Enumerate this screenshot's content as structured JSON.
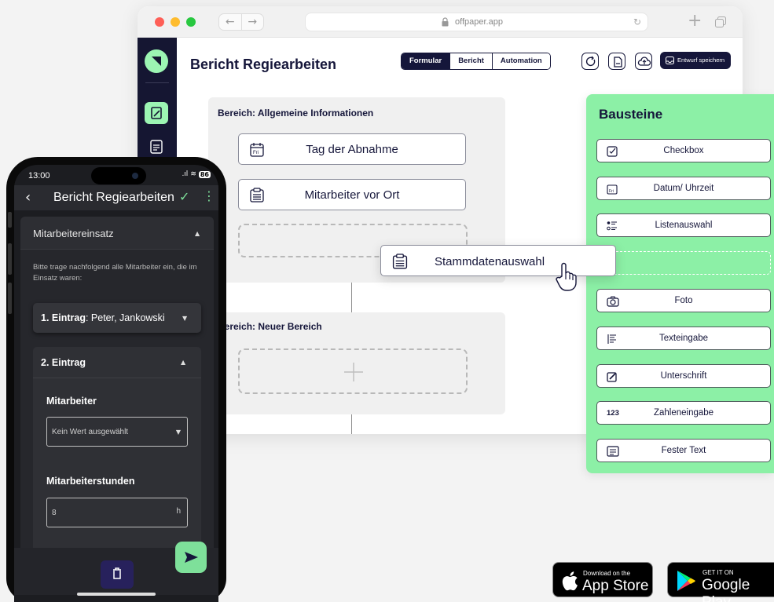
{
  "browser": {
    "url": "offpaper.app"
  },
  "app": {
    "page_title": "Bericht Regiearbeiten",
    "tabs": [
      {
        "label": "Formular",
        "active": true
      },
      {
        "label": "Bericht",
        "active": false
      },
      {
        "label": "Automation",
        "active": false
      }
    ],
    "save_label": "Entwurf speichern",
    "colors": {
      "navy": "#15163a",
      "mint": "#9cf5b3",
      "panel": "#8cf0a6"
    }
  },
  "canvas": {
    "section1": {
      "title": "Bereich: Allgemeine Informationen",
      "fields": [
        {
          "label": "Tag der Abnahme",
          "icon": "calendar-icon"
        },
        {
          "label": "Mitarbeiter vor Ort",
          "icon": "clipboard-icon"
        }
      ]
    },
    "section2": {
      "title": "Bereich: Neuer Bereich"
    },
    "dragged": {
      "label": "Stammdatenauswahl",
      "icon": "clipboard-icon"
    }
  },
  "panel": {
    "title": "Bausteine",
    "items": [
      {
        "label": "Checkbox",
        "icon": "checkbox-icon"
      },
      {
        "label": "Datum/ Uhrzeit",
        "icon": "calendar-icon"
      },
      {
        "label": "Listenauswahl",
        "icon": "list-icon"
      },
      {
        "label": "Foto",
        "icon": "camera-icon"
      },
      {
        "label": "Texteingabe",
        "icon": "text-input-icon"
      },
      {
        "label": "Unterschrift",
        "icon": "signature-icon"
      },
      {
        "label": "Zahleneingabe",
        "icon": "number-icon",
        "prefix": "123"
      },
      {
        "label": "Fester Text",
        "icon": "text-block-icon"
      }
    ]
  },
  "phone": {
    "time": "13:00",
    "battery": "86",
    "title": "Bericht Regiearbeiten",
    "section_title": "Mitarbeitereinsatz",
    "intro": "Bitte trage nachfolgend alle Mitarbeiter ein, die im Einsatz waren:",
    "entry1": {
      "prefix": "1. Eintrag",
      "value": ": Peter, Jankowski"
    },
    "entry2": {
      "title": "2. Eintrag",
      "field1_label": "Mitarbeiter",
      "field1_value": "Kein Wert ausgewählt",
      "field2_label": "Mitarbeiterstunden",
      "field2_value": "8",
      "field2_unit": "h"
    }
  },
  "badges": {
    "apple": {
      "small": "Download on the",
      "big": "App Store"
    },
    "google": {
      "small": "GET IT ON",
      "big": "Google Play"
    }
  }
}
